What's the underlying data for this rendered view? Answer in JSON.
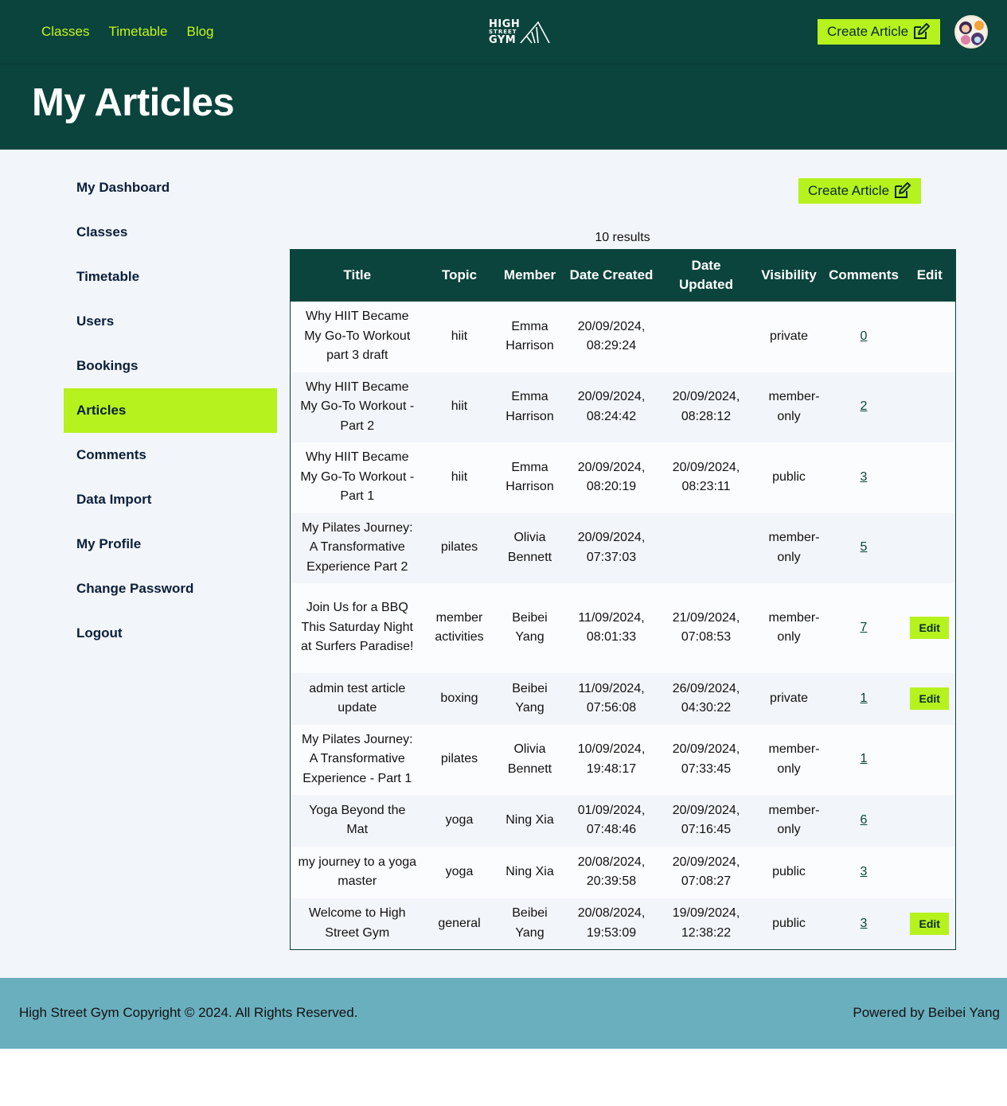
{
  "nav": {
    "links": [
      "Classes",
      "Timetable",
      "Blog"
    ],
    "logo": {
      "line1": "HIGH",
      "line2": "STREET",
      "line3": "GYM"
    },
    "create_label": "Create Article",
    "avatar_icon": "user-avatar-icon"
  },
  "header": {
    "title": "My Articles"
  },
  "sidebar": {
    "items": [
      {
        "label": "My Dashboard"
      },
      {
        "label": "Classes"
      },
      {
        "label": "Timetable"
      },
      {
        "label": "Users"
      },
      {
        "label": "Bookings"
      },
      {
        "label": "Articles"
      },
      {
        "label": "Comments"
      },
      {
        "label": "Data Import"
      },
      {
        "label": "My Profile"
      },
      {
        "label": "Change Password"
      },
      {
        "label": "Logout"
      }
    ],
    "active": "Articles"
  },
  "main": {
    "create_label": "Create Article",
    "results_text": "10 results"
  },
  "table": {
    "columns": [
      "Title",
      "Topic",
      "Member",
      "Date Created",
      "Date Updated",
      "Visibility",
      "Comments",
      "Edit"
    ],
    "edit_label": "Edit",
    "rows": [
      {
        "title": "Why HIIT Became My Go-To Workout part 3 draft",
        "topic": "hiit",
        "member": "Emma Harrison",
        "created": "20/09/2024, 08:29:24",
        "updated": "",
        "visibility": "private",
        "comments": "0",
        "editable": false
      },
      {
        "title": "Why HIIT Became My Go-To Workout - Part 2",
        "topic": "hiit",
        "member": "Emma Harrison",
        "created": "20/09/2024, 08:24:42",
        "updated": "20/09/2024, 08:28:12",
        "visibility": "member-only",
        "comments": "2",
        "editable": false
      },
      {
        "title": "Why HIIT Became My Go-To Workout - Part 1",
        "topic": "hiit",
        "member": "Emma Harrison",
        "created": "20/09/2024, 08:20:19",
        "updated": "20/09/2024, 08:23:11",
        "visibility": "public",
        "comments": "3",
        "editable": false
      },
      {
        "title": "My Pilates Journey: A Transformative Experience Part 2",
        "topic": "pilates",
        "member": "Olivia Bennett",
        "created": "20/09/2024, 07:37:03",
        "updated": "",
        "visibility": "member-only",
        "comments": "5",
        "editable": false
      },
      {
        "title": "Join Us for a BBQ This Saturday Night at Surfers Paradise!",
        "topic": "member activities",
        "member": "Beibei Yang",
        "created": "11/09/2024, 08:01:33",
        "updated": "21/09/2024, 07:08:53",
        "visibility": "member-only",
        "comments": "7",
        "editable": true
      },
      {
        "title": "admin test article update",
        "topic": "boxing",
        "member": "Beibei Yang",
        "created": "11/09/2024, 07:56:08",
        "updated": "26/09/2024, 04:30:22",
        "visibility": "private",
        "comments": "1",
        "editable": true
      },
      {
        "title": "My Pilates Journey: A Transformative Experience - Part 1",
        "topic": "pilates",
        "member": "Olivia Bennett",
        "created": "10/09/2024, 19:48:17",
        "updated": "20/09/2024, 07:33:45",
        "visibility": "member-only",
        "comments": "1",
        "editable": false
      },
      {
        "title": "Yoga Beyond the Mat",
        "topic": "yoga",
        "member": "Ning Xia",
        "created": "01/09/2024, 07:48:46",
        "updated": "20/09/2024, 07:16:45",
        "visibility": "member-only",
        "comments": "6",
        "editable": false
      },
      {
        "title": "my journey to a yoga master",
        "topic": "yoga",
        "member": "Ning Xia",
        "created": "20/08/2024, 20:39:58",
        "updated": "20/09/2024, 07:08:27",
        "visibility": "public",
        "comments": "3",
        "editable": false
      },
      {
        "title": "Welcome to High Street Gym",
        "topic": "general",
        "member": "Beibei Yang",
        "created": "20/08/2024, 19:53:09",
        "updated": "19/09/2024, 12:38:22",
        "visibility": "public",
        "comments": "3",
        "editable": true
      }
    ]
  },
  "footer": {
    "copyright": "High Street Gym Copyright © 2024. All Rights Reserved.",
    "powered": "Powered by Beibei Yang"
  },
  "colors": {
    "dark_green": "#0a443c",
    "lime": "#b5f21e",
    "footer": "#6aafbe",
    "page_bg": "#f2f5f9"
  }
}
